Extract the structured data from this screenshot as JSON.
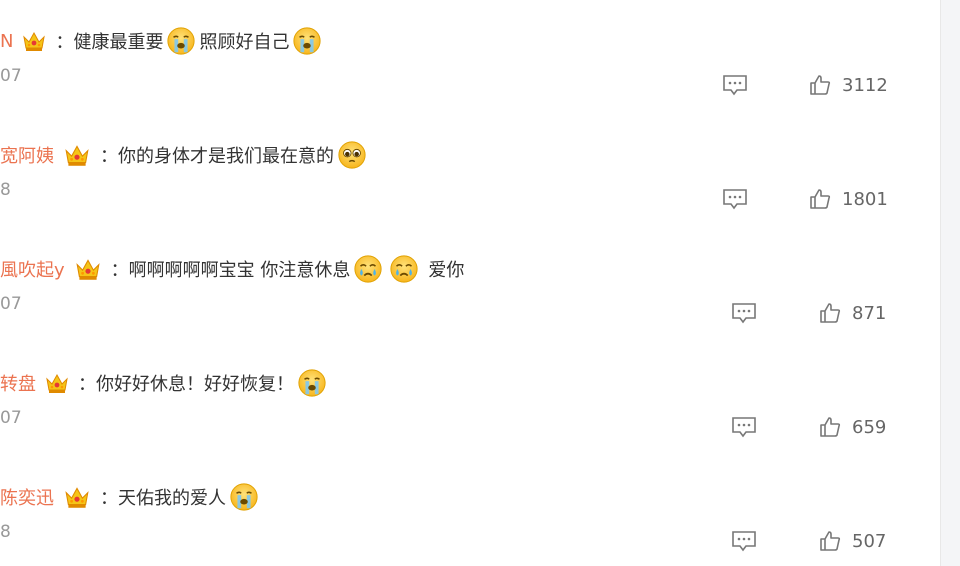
{
  "comments": [
    {
      "username": "N",
      "content": [
        "：健康最重要",
        "照顾好自己"
      ],
      "emoji": [
        "crying-face",
        "crying-face"
      ],
      "time": "07",
      "likes": "3112"
    },
    {
      "username": "宽阿姨",
      "content": [
        "：你的身体才是我们最在意的"
      ],
      "emoji": [
        "pleading-face"
      ],
      "time": "8",
      "likes": "1801"
    },
    {
      "username": "風吹起y",
      "content": [
        "：啊啊啊啊啊宝宝 你注意休息",
        "爱你"
      ],
      "emoji": [
        "sobbing-face",
        "sobbing-face"
      ],
      "time": "07",
      "likes": "871"
    },
    {
      "username": "转盘",
      "content": [
        "：你好好休息！好好恢复！"
      ],
      "emoji": [
        "crying-face"
      ],
      "time": "07",
      "likes": "659"
    },
    {
      "username": "陈奕迅",
      "content": [
        "：天佑我的爱人"
      ],
      "emoji": [
        "crying-face"
      ],
      "time": "8",
      "likes": "507"
    }
  ],
  "colors": {
    "username": "#eb7350",
    "text": "#333333",
    "meta": "#999999",
    "icon": "#666666",
    "emoji_face": "#fcc21b"
  }
}
